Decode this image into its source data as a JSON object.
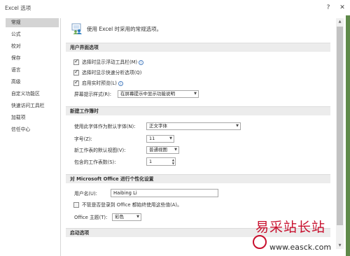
{
  "window": {
    "title": "Excel 选项",
    "help_label": "?",
    "close_label": "✕"
  },
  "sidebar": {
    "items": [
      {
        "label": "常规",
        "active": true
      },
      {
        "label": "公式"
      },
      {
        "label": "校对"
      },
      {
        "label": "保存"
      },
      {
        "label": "语言"
      },
      {
        "label": "高级"
      },
      {
        "label": "自定义功能区"
      },
      {
        "label": "快速访问工具栏"
      },
      {
        "label": "加载项"
      },
      {
        "label": "信任中心"
      }
    ]
  },
  "intro": {
    "text": "使用 Excel 时采用的常规选项。"
  },
  "ui_options": {
    "header": "用户界面选项",
    "mini_toolbar": "选择时显示浮动工具栏(M)",
    "quick_analysis": "选择时显示快速分析选项(Q)",
    "live_preview": "启用实时预览(L)",
    "screentip_label": "屏幕提示样式(R):",
    "screentip_value": "在屏幕提示中显示功能说明"
  },
  "new_workbook": {
    "header": "新建工作簿时",
    "font_label": "使用此字体作为默认字体(N):",
    "font_value": "正文字体",
    "size_label": "字号(Z):",
    "size_value": "11",
    "view_label": "新工作表的默认视图(V):",
    "view_value": "普通视图",
    "sheets_label": "包含的工作表数(S):",
    "sheets_value": "1"
  },
  "personalize": {
    "header": "对 Microsoft Office 进行个性化设置",
    "username_label": "用户名(U):",
    "username_value": "Haibing Li",
    "always_use": "不管是否登录到 Office 都始终使用这些值(A)。",
    "theme_label": "Office 主题(T):",
    "theme_value": "彩色"
  },
  "startup": {
    "header": "启动选项"
  },
  "watermark": {
    "title": "易采站长站",
    "url": "www.easck.com"
  }
}
